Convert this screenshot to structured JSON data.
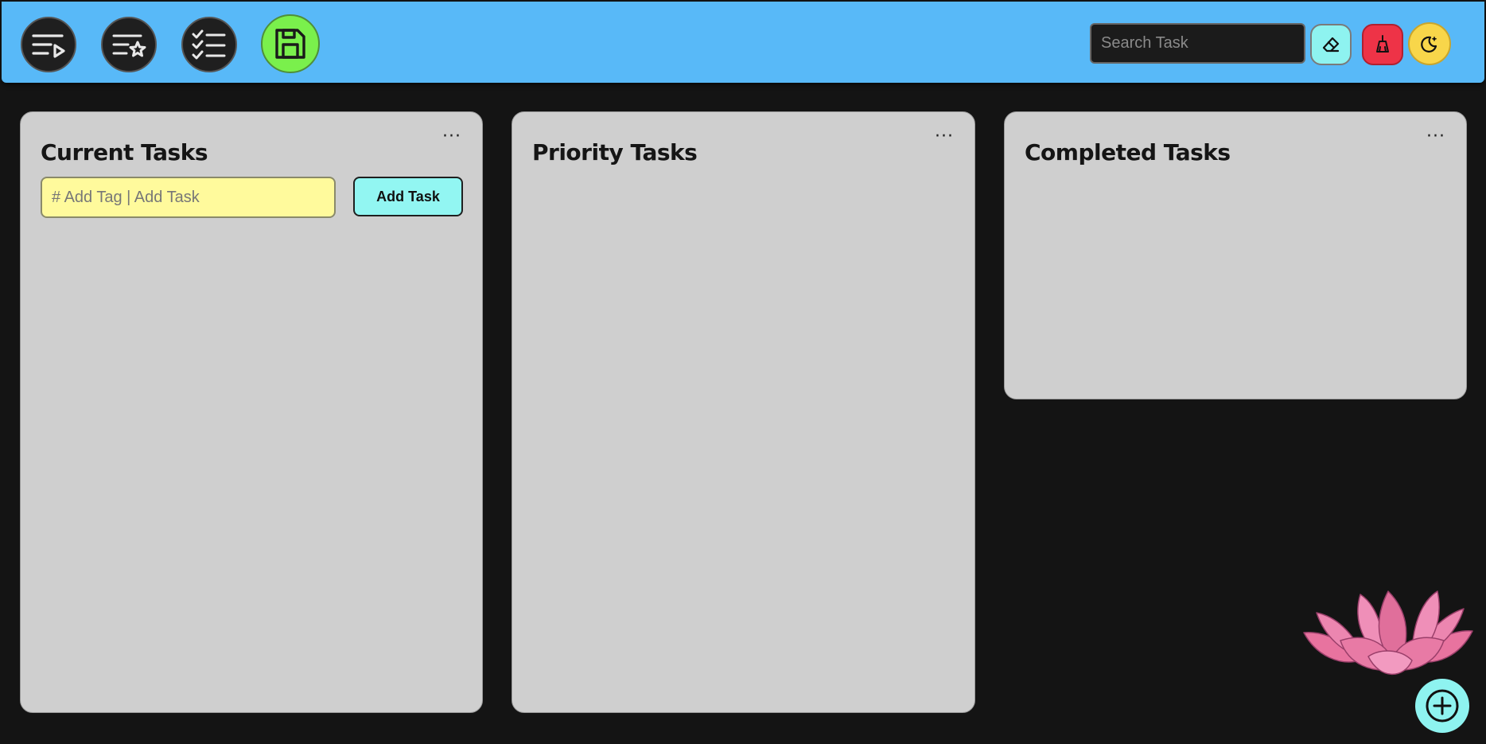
{
  "header": {
    "nav": [
      {
        "name": "current-tasks-nav-button",
        "icon": "list-play-icon"
      },
      {
        "name": "priority-tasks-nav-button",
        "icon": "list-star-icon"
      },
      {
        "name": "completed-tasks-nav-button",
        "icon": "list-check-icon"
      }
    ],
    "save_icon": "floppy-disk-icon",
    "search": {
      "placeholder": "Search Task",
      "value": ""
    },
    "eraser_icon": "eraser-icon",
    "clear_icon": "broom-icon",
    "theme_icon": "moon-star-icon"
  },
  "panels": {
    "current": {
      "title": "Current Tasks",
      "menu": "···",
      "input_placeholder": "# Add Tag | Add Task",
      "add_label": "Add Task"
    },
    "priority": {
      "title": "Priority Tasks",
      "menu": "···"
    },
    "completed": {
      "title": "Completed Tasks",
      "menu": "···"
    }
  },
  "decor": {
    "lotus_icon": "lotus-flower-icon",
    "fab_icon": "plus-circle-icon"
  },
  "colors": {
    "header_bg": "#58b9f8",
    "page_bg": "#141414",
    "panel_bg": "#cfcfcf",
    "save_green": "#7af04c",
    "accent_cyan": "#8ef3f0",
    "danger_red": "#ee3347",
    "theme_yellow": "#f8d64a",
    "input_yellow": "#fffa9c"
  }
}
